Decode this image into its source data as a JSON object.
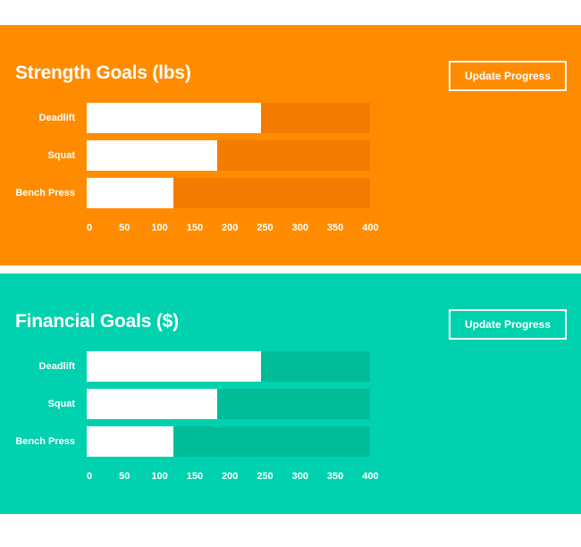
{
  "axis": {
    "min": 0,
    "max": 400,
    "ticks": [
      "0",
      "50",
      "100",
      "150",
      "200",
      "250",
      "300",
      "350",
      "400"
    ]
  },
  "panels": [
    {
      "title": "Strength Goals (lbs)",
      "button_label": "Update Progress",
      "bg_color": "#ff8c00",
      "track_color": "#f27b00",
      "rows": [
        {
          "label": "Deadlift",
          "value": 246
        },
        {
          "label": "Squat",
          "value": 184
        },
        {
          "label": "Bench Press",
          "value": 123
        }
      ]
    },
    {
      "title": "Financial Goals ($)",
      "button_label": "Update Progress",
      "bg_color": "#00d1ae",
      "track_color": "#00bd98",
      "rows": [
        {
          "label": "Deadlift",
          "value": 246
        },
        {
          "label": "Squat",
          "value": 184
        },
        {
          "label": "Bench Press",
          "value": 123
        }
      ]
    }
  ],
  "chart_data": [
    {
      "type": "bar",
      "title": "Strength Goals (lbs)",
      "categories": [
        "Deadlift",
        "Squat",
        "Bench Press"
      ],
      "values": [
        246,
        184,
        123
      ],
      "xlim": [
        0,
        400
      ]
    },
    {
      "type": "bar",
      "title": "Financial Goals ($)",
      "categories": [
        "Deadlift",
        "Squat",
        "Bench Press"
      ],
      "values": [
        246,
        184,
        123
      ],
      "xlim": [
        0,
        400
      ]
    }
  ]
}
